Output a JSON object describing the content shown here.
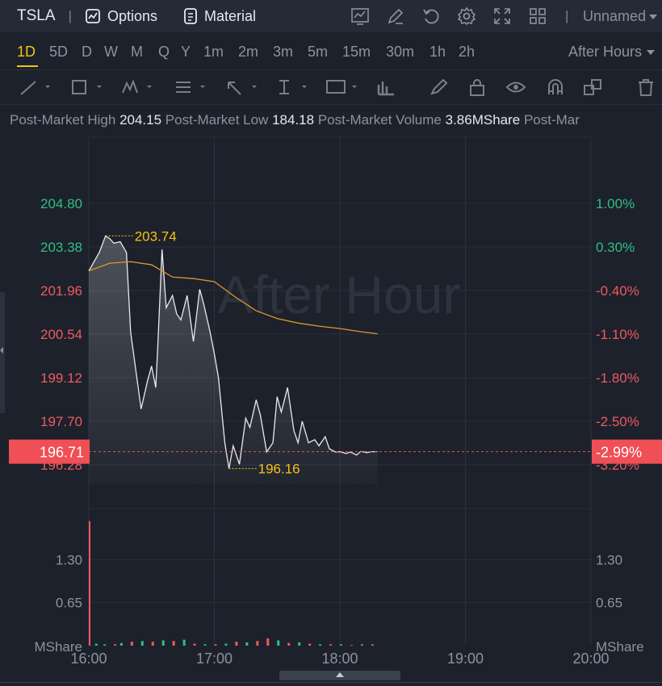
{
  "header": {
    "symbol": "TSLA",
    "options_label": "Options",
    "material_label": "Material",
    "layout_name": "Unnamed"
  },
  "timeframes": [
    "1D",
    "5D",
    "D",
    "W",
    "M",
    "Q",
    "Y",
    "1m",
    "2m",
    "3m",
    "5m",
    "15m",
    "30m",
    "1h",
    "2h"
  ],
  "active_timeframe": "1D",
  "session_label": "After Hours",
  "stats": [
    {
      "label": "Post-Market High",
      "value": "204.15"
    },
    {
      "label": "Post-Market Low",
      "value": "184.18"
    },
    {
      "label": "Post-Market Volume",
      "value": "3.86MShare"
    },
    {
      "label": "Post-Mar",
      "value": ""
    }
  ],
  "colors": {
    "background": "#1c212b",
    "price_line": "#e8eaee",
    "avg_line": "#e0962a",
    "up": "#2fbf85",
    "down": "#ef5a5f",
    "annotation": "#f3c316",
    "current_tag": "#ef4f55"
  },
  "chart_data": {
    "type": "line",
    "watermark": "After Hour",
    "x_ticks": [
      "16:00",
      "17:00",
      "18:00",
      "19:00",
      "20:00"
    ],
    "x_range": [
      "16:00",
      "20:00"
    ],
    "price_ticks": [
      "204.80",
      "203.38",
      "201.96",
      "200.54",
      "199.12",
      "197.70",
      "196.28"
    ],
    "percent_ticks": [
      "1.00%",
      "0.30%",
      "-0.40%",
      "-1.10%",
      "-1.80%",
      "-2.50%",
      "-3.20%"
    ],
    "ylim": [
      196.28,
      204.8
    ],
    "current_price": "196.71",
    "current_percent": "-2.99%",
    "high_annotation": "203.74",
    "low_annotation": "196.16",
    "series": [
      {
        "type": "price",
        "x": [
          "16:00",
          "16:05",
          "16:08",
          "16:10",
          "16:12",
          "16:15",
          "16:18",
          "16:20",
          "16:25",
          "16:28",
          "16:30",
          "16:32",
          "16:33",
          "16:35",
          "16:37",
          "16:40",
          "16:42",
          "16:44",
          "16:47",
          "16:50",
          "16:53",
          "16:55",
          "16:58",
          "17:00",
          "17:02",
          "17:05",
          "17:07",
          "17:09",
          "17:12",
          "17:15",
          "17:17",
          "17:20",
          "17:22",
          "17:25",
          "17:28",
          "17:30",
          "17:32",
          "17:35",
          "17:38",
          "17:40",
          "17:42",
          "17:45",
          "17:48",
          "17:50",
          "17:53",
          "17:55",
          "17:58",
          "18:00",
          "18:03",
          "18:05",
          "18:08",
          "18:10",
          "18:13",
          "18:15",
          "18:18"
        ],
        "y": [
          202.6,
          203.2,
          203.74,
          203.65,
          203.5,
          203.55,
          203.2,
          200.6,
          198.1,
          199.0,
          199.5,
          198.8,
          200.2,
          203.3,
          201.4,
          201.8,
          201.2,
          201.0,
          201.8,
          200.3,
          202.0,
          201.5,
          200.6,
          199.9,
          199.1,
          197.0,
          196.16,
          196.9,
          196.3,
          197.8,
          197.5,
          198.4,
          197.9,
          196.7,
          197.0,
          198.5,
          198.0,
          198.8,
          197.4,
          197.0,
          197.7,
          197.0,
          197.1,
          196.9,
          197.2,
          196.8,
          196.7,
          196.71,
          196.65,
          196.7,
          196.6,
          196.72,
          196.68,
          196.71,
          196.71
        ]
      },
      {
        "type": "average",
        "x": [
          "16:00",
          "16:10",
          "16:20",
          "16:30",
          "16:40",
          "16:50",
          "17:00",
          "17:10",
          "17:20",
          "17:30",
          "17:40",
          "17:50",
          "18:00",
          "18:10",
          "18:18"
        ],
        "y": [
          202.6,
          202.85,
          202.9,
          202.8,
          202.4,
          202.35,
          202.25,
          201.75,
          201.3,
          201.05,
          200.9,
          200.8,
          200.72,
          200.62,
          200.55
        ]
      }
    ],
    "volume": {
      "ticks": [
        "1.30",
        "0.65"
      ],
      "unit": "MShare",
      "ylim": [
        0,
        1.95
      ],
      "x": [
        "16:00",
        "16:03",
        "16:07",
        "16:12",
        "16:15",
        "16:20",
        "16:25",
        "16:30",
        "16:35",
        "16:40",
        "16:45",
        "16:50",
        "16:55",
        "17:00",
        "17:05",
        "17:10",
        "17:15",
        "17:20",
        "17:25",
        "17:30",
        "17:35",
        "17:40",
        "17:45",
        "17:50",
        "17:55",
        "18:00",
        "18:05",
        "18:10",
        "18:15"
      ],
      "values": [
        1.88,
        0.03,
        0.02,
        0.02,
        0.04,
        0.06,
        0.07,
        0.06,
        0.08,
        0.07,
        0.09,
        0.03,
        0.02,
        0.02,
        0.03,
        0.06,
        0.05,
        0.07,
        0.11,
        0.08,
        0.04,
        0.05,
        0.03,
        0.02,
        0.02,
        0.02,
        0.01,
        0.02,
        0.02
      ],
      "up": [
        false,
        true,
        true,
        false,
        true,
        false,
        true,
        false,
        true,
        false,
        true,
        false,
        true,
        false,
        true,
        false,
        true,
        false,
        false,
        true,
        false,
        true,
        false,
        true,
        false,
        true,
        false,
        true,
        false
      ]
    }
  }
}
